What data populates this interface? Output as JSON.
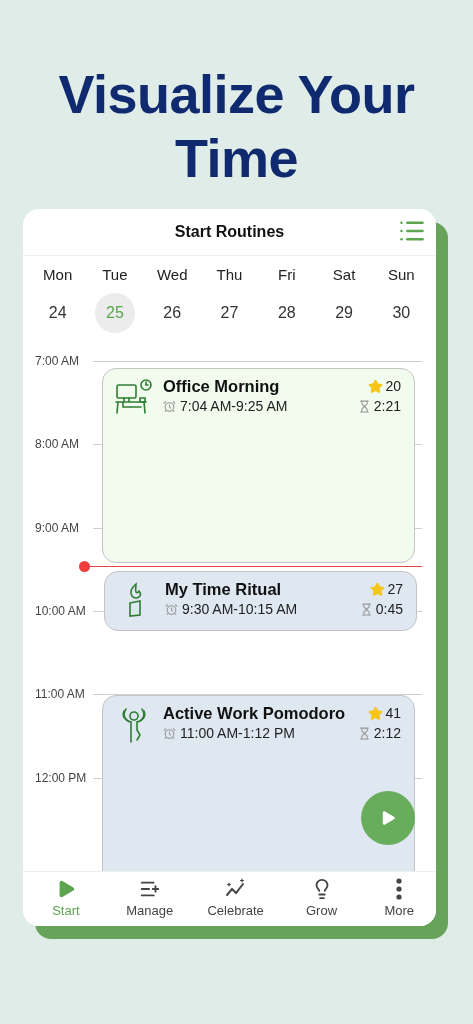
{
  "headline": "Visualize Your Time",
  "header": {
    "title": "Start Routines"
  },
  "days": [
    {
      "name": "Mon",
      "date": "24",
      "selected": false
    },
    {
      "name": "Tue",
      "date": "25",
      "selected": true
    },
    {
      "name": "Wed",
      "date": "26",
      "selected": false
    },
    {
      "name": "Thu",
      "date": "27",
      "selected": false
    },
    {
      "name": "Fri",
      "date": "28",
      "selected": false
    },
    {
      "name": "Sat",
      "date": "29",
      "selected": false
    },
    {
      "name": "Sun",
      "date": "30",
      "selected": false
    }
  ],
  "hours": [
    "7:00 AM",
    "8:00 AM",
    "9:00 AM",
    "10:00 AM",
    "11:00 AM",
    "12:00 PM"
  ],
  "routines": [
    {
      "kind": "desk",
      "title": "Office Morning",
      "time": "7:04 AM-9:25 AM",
      "stars": "20",
      "duration": "2:21",
      "color": "#f1fbee"
    },
    {
      "kind": "flame",
      "title": "My Time Ritual",
      "time": "9:30 AM-10:15 AM",
      "stars": "27",
      "duration": "0:45",
      "color": "#dfe7f1"
    },
    {
      "kind": "person",
      "title": "Active Work Pomodoro",
      "time": "11:00 AM-1:12 PM",
      "stars": "41",
      "duration": "2:12",
      "color": "#dfe7f1"
    }
  ],
  "tabs": [
    {
      "label": "Start",
      "kind": "play",
      "selected": true
    },
    {
      "label": "Manage",
      "kind": "list-plus",
      "selected": false
    },
    {
      "label": "Celebrate",
      "kind": "sparkle-chart",
      "selected": false
    },
    {
      "label": "Grow",
      "kind": "bulb",
      "selected": false
    },
    {
      "label": "More",
      "kind": "dots",
      "selected": false
    }
  ]
}
